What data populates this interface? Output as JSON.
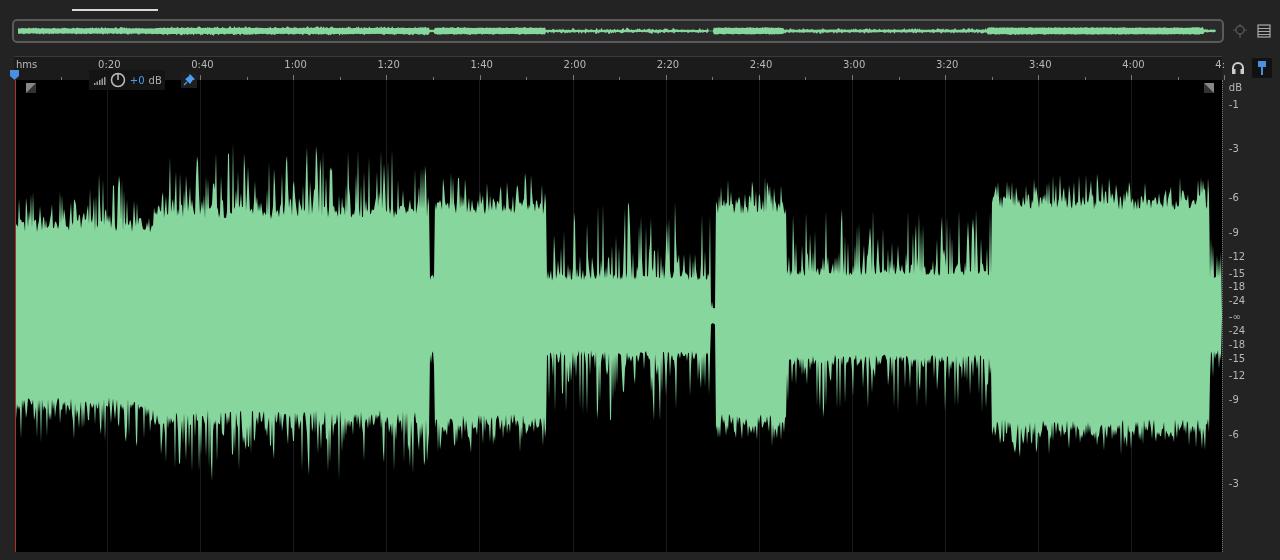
{
  "ruler": {
    "unit": "hms",
    "labels": [
      "0:20",
      "0:40",
      "1:00",
      "1:20",
      "1:40",
      "2:00",
      "2:20",
      "2:40",
      "3:00",
      "3:20",
      "3:40",
      "4:00",
      "4:"
    ]
  },
  "hud": {
    "gain_value": "+0",
    "gain_unit": "dB"
  },
  "db_scale": {
    "unit": "dB",
    "labels": [
      "-1",
      "-3",
      "-6",
      "-9",
      "-12",
      "-15",
      "-18",
      "-24",
      "-∞",
      "-24",
      "-18",
      "-15",
      "-12",
      "-9",
      "-6",
      "-3"
    ]
  }
}
